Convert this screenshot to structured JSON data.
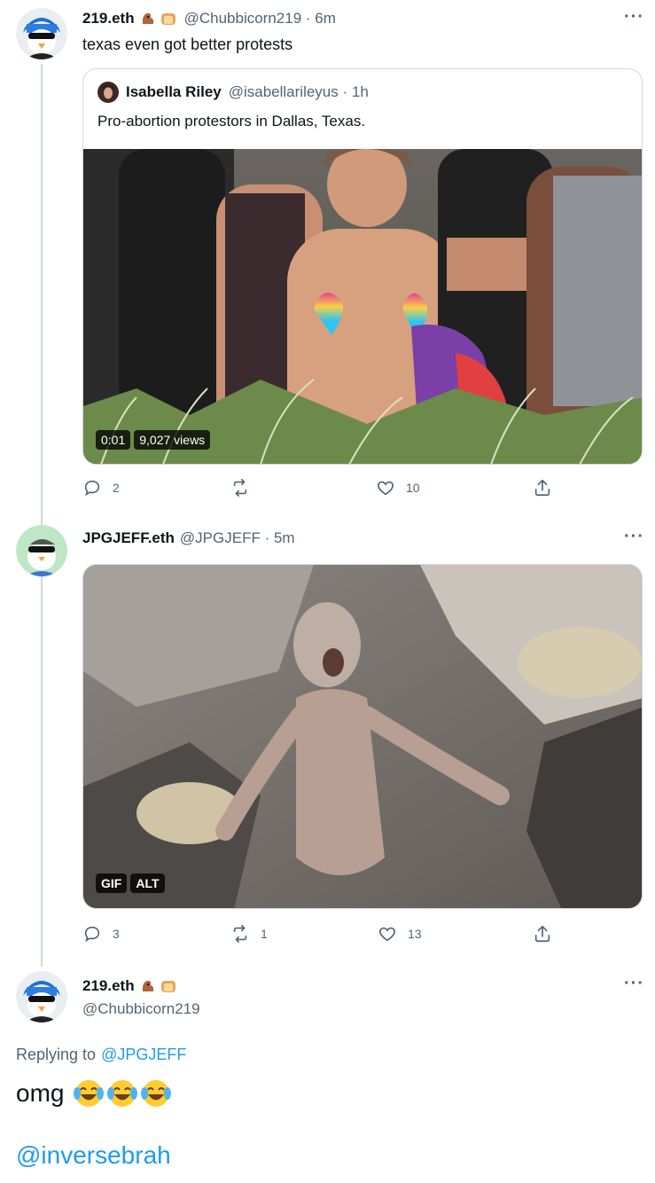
{
  "tweet1": {
    "name": "219.eth",
    "handle": "@Chubbicorn219 · 6m",
    "text": "texas even got better protests",
    "quote": {
      "name": "Isabella Riley",
      "handle": "@isabellarileyus · 1h",
      "text": "Pro-abortion protestors in Dallas, Texas.",
      "video_time": "0:01",
      "video_views": "9,027 views"
    },
    "actions": {
      "reply": "2",
      "retweet": "",
      "like": "10"
    }
  },
  "tweet2": {
    "name": "JPGJEFF.eth",
    "handle": "@JPGJEFF · 5m",
    "gif_label": "GIF",
    "alt_label": "ALT",
    "actions": {
      "reply": "3",
      "retweet": "1",
      "like": "13"
    }
  },
  "tweet3": {
    "name": "219.eth",
    "handle": "@Chubbicorn219",
    "replying_prefix": "Replying to",
    "replying_handle": "@JPGJEFF",
    "text": "omg",
    "mention": "@inversebrah"
  },
  "icons": {
    "reply": "reply-icon",
    "retweet": "retweet-icon",
    "like": "heart-icon",
    "share": "share-icon",
    "more": "more-icon",
    "emoji": "laughing-crying-emoji"
  },
  "colors": {
    "accent": "#1d9bf0",
    "muted": "#536471",
    "border": "#cfd9de"
  }
}
